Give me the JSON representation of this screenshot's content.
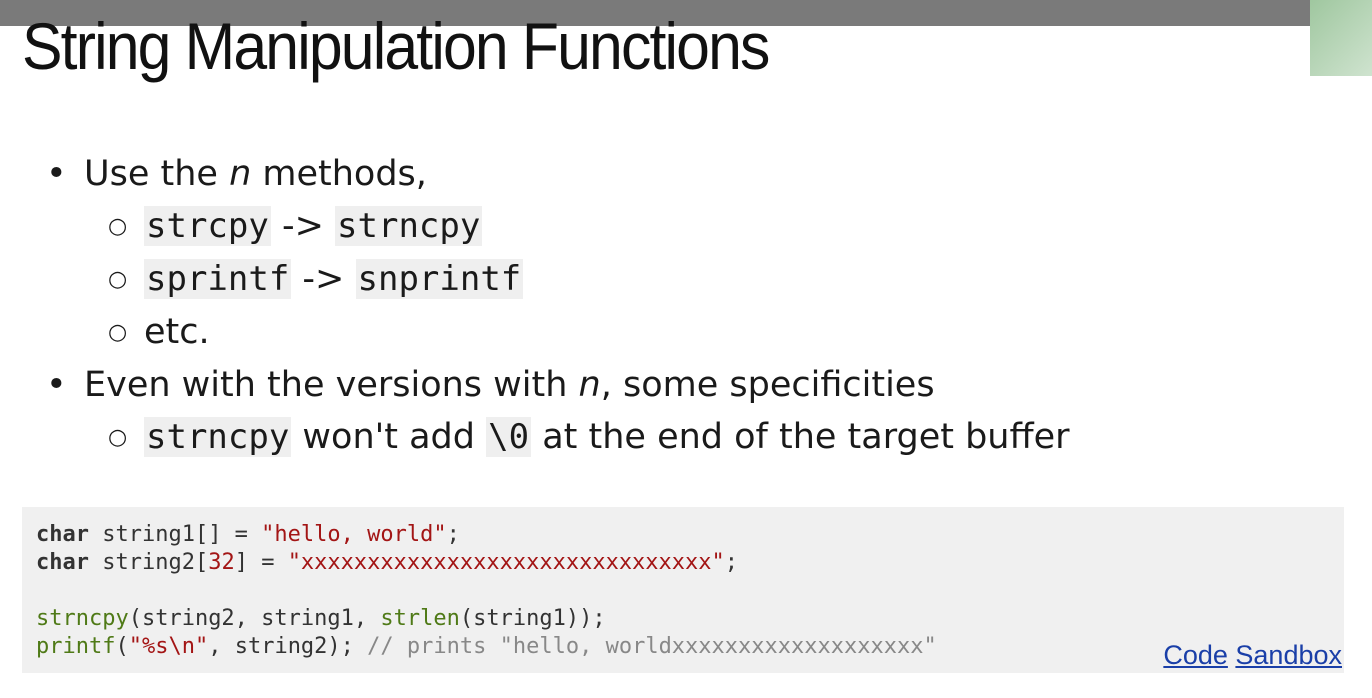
{
  "slide": {
    "title": "String Manipulation Functions",
    "bullet1": {
      "pre": "Use the ",
      "em": "n",
      "post": " methods,"
    },
    "sub1": [
      {
        "a": "strcpy",
        "arrow": " -> ",
        "b": "strncpy"
      },
      {
        "a": "sprintf",
        "arrow": " -> ",
        "b": "snprintf"
      }
    ],
    "sub1_etc": "etc.",
    "bullet2": {
      "pre": "Even with the versions with ",
      "em": "n",
      "post": ", some specificities"
    },
    "sub2": {
      "code1": "strncpy",
      "mid": " won't add ",
      "code2": "\\0",
      "post": " at the end of the target buffer"
    }
  },
  "code": {
    "l1": {
      "kw": "char",
      "rest": " string1[] = ",
      "str": "\"hello, world\"",
      "end": ";"
    },
    "l2": {
      "kw": "char",
      "rest": " string2[",
      "num": "32",
      "rest2": "] = ",
      "str": "\"xxxxxxxxxxxxxxxxxxxxxxxxxxxxxxx\"",
      "end": ";"
    },
    "l3": {
      "fn1": "strncpy",
      "a": "(string2, string1, ",
      "fn2": "strlen",
      "b": "(string1));"
    },
    "l4": {
      "fn": "printf",
      "a": "(",
      "str": "\"%s\\n\"",
      "b": ", string2); ",
      "cmt": "// prints \"hello, worldxxxxxxxxxxxxxxxxxxx\""
    }
  },
  "links": {
    "code": "Code",
    "sandbox": "Sandbox"
  }
}
